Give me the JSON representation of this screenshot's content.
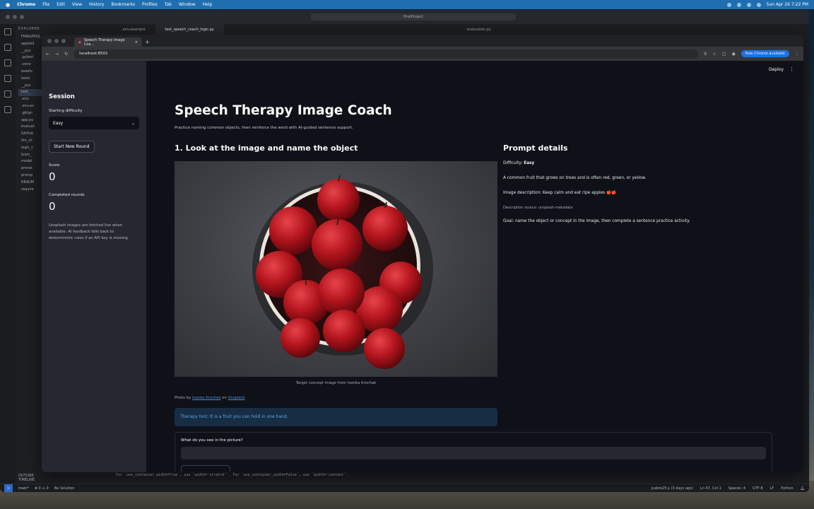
{
  "menubar": {
    "app": "Chrome",
    "items": [
      "File",
      "Edit",
      "View",
      "History",
      "Bookmarks",
      "Profiles",
      "Tab",
      "Window",
      "Help"
    ],
    "datetime": "Sun Apr 26  7:22 PM"
  },
  "vscode": {
    "search": "finalProject",
    "explorer_header": "EXPLORER",
    "tree": [
      "FINALPROJ...",
      "applied",
      "__pyc",
      ".pytest",
      ".venv",
      "assets",
      "tests",
      "__pyc",
      "test_",
      ".env",
      ".env.ex",
      ".gitign",
      "app.py",
      "evaluat",
      "GitHub",
      "llm_cli",
      "logic_c",
      "loom_",
      "model",
      "previe",
      "promp",
      "READM",
      "require"
    ],
    "outline": "OUTLINE",
    "timeline": "TIMELINE",
    "tabs": [
      ".env.example",
      "test_speech_coach_logic.py",
      "evaluation.py"
    ],
    "terminal_line": "For `use_container_width=True`, use `width='stretch'`. For `use_container_width=False`, use `width='content'`.",
    "status": {
      "branch": "main*",
      "problems": "⊗ 0 ⚠ 0",
      "solution": "No Solution",
      "author": "jcabre25-y (3 days ago)",
      "position": "Ln 47, Col 1",
      "spaces": "Spaces: 4",
      "encoding": "UTF-8",
      "eol": "LF",
      "language": "Python"
    }
  },
  "chrome": {
    "tab_title": "Speech Therapy Image Coa...",
    "url": "localhost:8501",
    "update_label": "New Chrome available"
  },
  "sidebar": {
    "title": "Session",
    "difficulty_label": "Starting difficulty",
    "difficulty_value": "Easy",
    "new_round_label": "Start New Round",
    "score_label": "Score",
    "score_value": "0",
    "rounds_label": "Completed rounds",
    "rounds_value": "0",
    "note": "Unsplash images are fetched live when available. AI feedback falls back to deterministic rules if an API key is missing."
  },
  "main": {
    "deploy_label": "Deploy",
    "title": "Speech Therapy Image Coach",
    "subtitle": "Practice naming common objects, then reinforce the word with AI-guided sentence support.",
    "step_heading": "1. Look at the image and name the object",
    "image_caption": "Target concept image from Ivanka Krochak",
    "credit_prefix": "Photo by",
    "credit_author": "Ivanka Krochak",
    "credit_middle": "on",
    "credit_source": "Unsplash",
    "hint": "Therapy hint: It is a fruit you can hold in one hand.",
    "answer_label": "What do you see in the picture?"
  },
  "prompt": {
    "heading": "Prompt details",
    "difficulty_prefix": "Difficulty:",
    "difficulty_value": "Easy",
    "clue": "A common fruit that grows on trees and is often red, green, or yellow.",
    "image_description": "Image description: Keep calm and eat ripe apples 🍎🍎",
    "source": "Description source: unsplash-metadata",
    "goal": "Goal: name the object or concept in the image, then complete a sentence practice activity."
  },
  "colors": {
    "app_background": "#0e1117",
    "sidebar_background": "#262730",
    "hint_background": "#172d43",
    "hint_text": "#5ea8e6",
    "chrome_update": "#1a73e8",
    "apple_red": "#b1141c"
  }
}
